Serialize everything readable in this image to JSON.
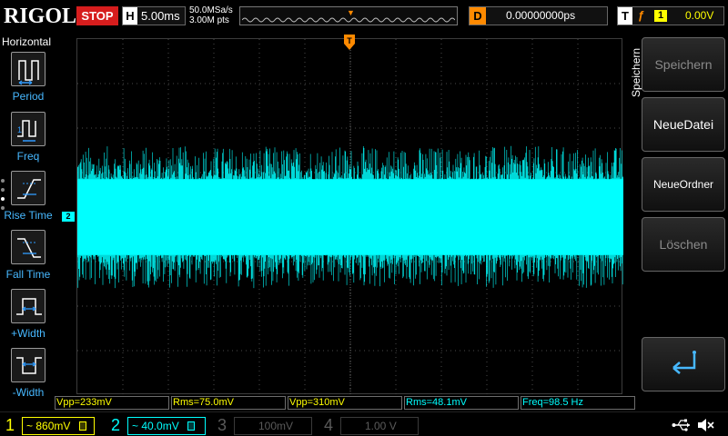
{
  "top": {
    "brand": "RIGOL",
    "run_state": "STOP",
    "horizontal_letter": "H",
    "timebase": "5.00ms",
    "sample_rate": "50.0MSa/s",
    "mem_depth": "3.00M pts",
    "delay_letter": "D",
    "delay": "0.00000000ps",
    "trigger_letter": "T",
    "trigger_source": "1",
    "trigger_level": "0.00V",
    "trigger_pos_marker": "T"
  },
  "left_panel": {
    "title": "Horizontal",
    "items": [
      {
        "label": "Period",
        "icon": "period-icon"
      },
      {
        "label": "Freq",
        "icon": "freq-icon"
      },
      {
        "label": "Rise Time",
        "icon": "rise-time-icon"
      },
      {
        "label": "Fall Time",
        "icon": "fall-time-icon"
      },
      {
        "label": "+Width",
        "icon": "positive-width-icon"
      },
      {
        "label": "-Width",
        "icon": "negative-width-icon"
      }
    ]
  },
  "markers": {
    "ch2": "2",
    "trigger": "T"
  },
  "right_menu": {
    "title": "Speichern",
    "buttons": [
      {
        "label": "Speichern",
        "state": "disabled"
      },
      {
        "label": "NeueDatei",
        "state": "active"
      },
      {
        "label": "NeueOrdner",
        "state": "active"
      },
      {
        "label": "Löschen",
        "state": "disabled"
      }
    ],
    "back_icon": "return-arrow-icon"
  },
  "results": [
    {
      "text": "Vpp=233mV",
      "channel": 1
    },
    {
      "text": "Rms=75.0mV",
      "channel": 1
    },
    {
      "text": "Vpp=310mV",
      "channel": 1
    },
    {
      "text": "Rms=48.1mV",
      "channel": 2
    },
    {
      "text": "Freq=98.5 Hz",
      "channel": 2
    }
  ],
  "channels": [
    {
      "num": "1",
      "coupling": "~",
      "scale": "860mV",
      "color": "#ffff00"
    },
    {
      "num": "2",
      "coupling": "~",
      "scale": "40.0mV",
      "color": "#00ffff"
    },
    {
      "num": "3",
      "coupling": "",
      "scale": "100mV",
      "color": "#5a5a5a"
    },
    {
      "num": "4",
      "coupling": "",
      "scale": "1.00 V",
      "color": "#5a5a5a"
    }
  ],
  "colors": {
    "ch1": "#ffff00",
    "ch2": "#00ffff",
    "trigger": "#ff8a00",
    "stop": "#d61d1d",
    "grid": "#4a4a4a"
  },
  "waveform": {
    "channel": 2,
    "kind": "noise",
    "center_div": 0,
    "envelope_peak_div": 1.5,
    "envelope_core_div": 0.85
  }
}
